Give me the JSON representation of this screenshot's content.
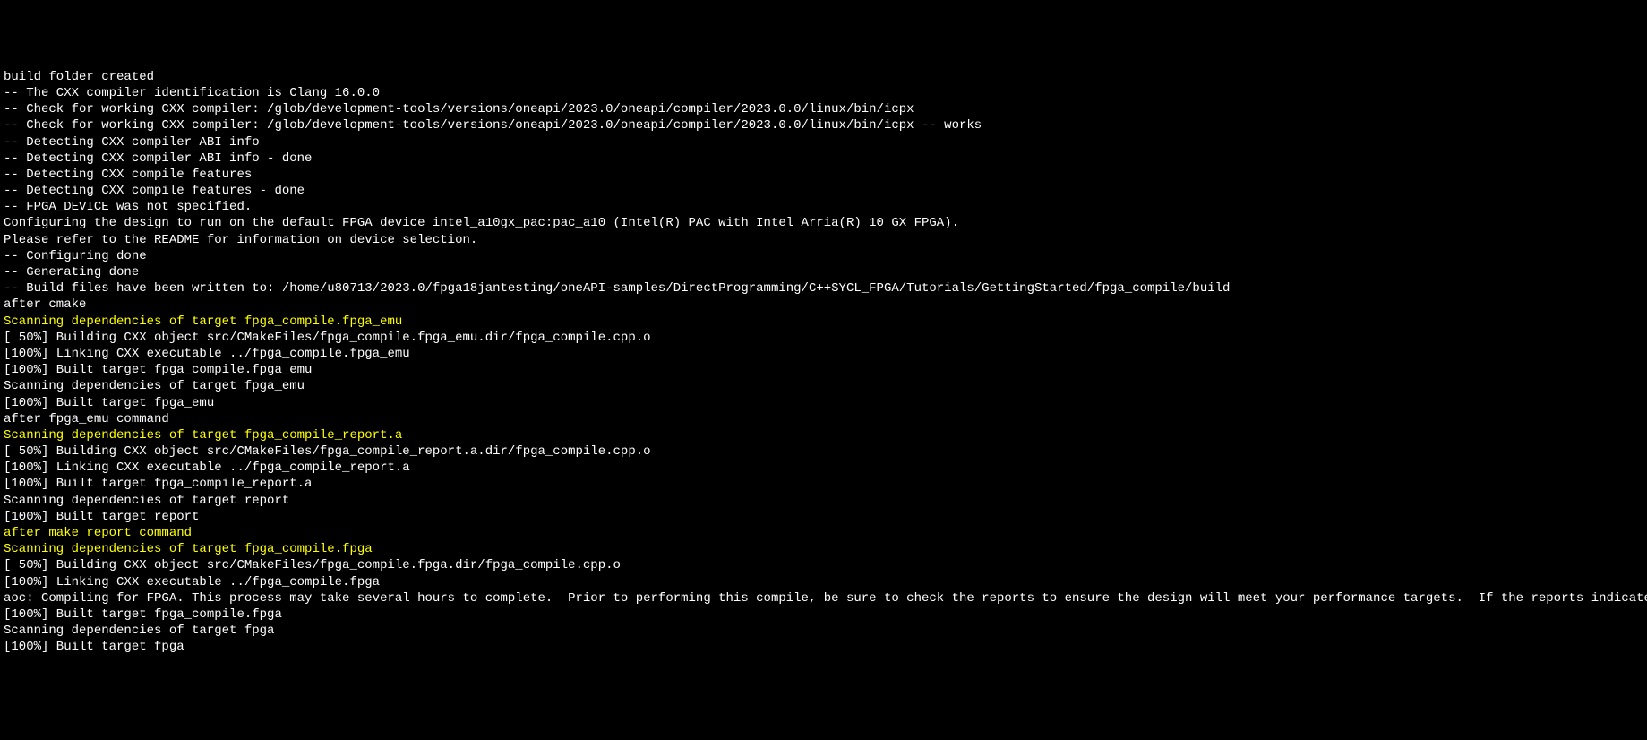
{
  "terminal": {
    "lines": [
      {
        "text": "build folder created",
        "color": "white"
      },
      {
        "text": "-- The CXX compiler identification is Clang 16.0.0",
        "color": "white"
      },
      {
        "text": "-- Check for working CXX compiler: /glob/development-tools/versions/oneapi/2023.0/oneapi/compiler/2023.0.0/linux/bin/icpx",
        "color": "white"
      },
      {
        "text": "-- Check for working CXX compiler: /glob/development-tools/versions/oneapi/2023.0/oneapi/compiler/2023.0.0/linux/bin/icpx -- works",
        "color": "white"
      },
      {
        "text": "-- Detecting CXX compiler ABI info",
        "color": "white"
      },
      {
        "text": "-- Detecting CXX compiler ABI info - done",
        "color": "white"
      },
      {
        "text": "-- Detecting CXX compile features",
        "color": "white"
      },
      {
        "text": "-- Detecting CXX compile features - done",
        "color": "white"
      },
      {
        "text": "-- FPGA_DEVICE was not specified.",
        "color": "white"
      },
      {
        "text": "Configuring the design to run on the default FPGA device intel_a10gx_pac:pac_a10 (Intel(R) PAC with Intel Arria(R) 10 GX FPGA).",
        "color": "white"
      },
      {
        "text": "Please refer to the README for information on device selection.",
        "color": "white"
      },
      {
        "text": "-- Configuring done",
        "color": "white"
      },
      {
        "text": "-- Generating done",
        "color": "white"
      },
      {
        "text": "-- Build files have been written to: /home/u80713/2023.0/fpga18jantesting/oneAPI-samples/DirectProgramming/C++SYCL_FPGA/Tutorials/GettingStarted/fpga_compile/build",
        "color": "white"
      },
      {
        "text": "after cmake",
        "color": "white"
      },
      {
        "text": "Scanning dependencies of target fpga_compile.fpga_emu",
        "color": "yellow"
      },
      {
        "text": "[ 50%] Building CXX object src/CMakeFiles/fpga_compile.fpga_emu.dir/fpga_compile.cpp.o",
        "color": "white"
      },
      {
        "text": "[100%] Linking CXX executable ../fpga_compile.fpga_emu",
        "color": "white"
      },
      {
        "text": "[100%] Built target fpga_compile.fpga_emu",
        "color": "white"
      },
      {
        "text": "Scanning dependencies of target fpga_emu",
        "color": "white"
      },
      {
        "text": "[100%] Built target fpga_emu",
        "color": "white"
      },
      {
        "text": "after fpga_emu command",
        "color": "white"
      },
      {
        "text": "Scanning dependencies of target fpga_compile_report.a",
        "color": "yellow"
      },
      {
        "text": "[ 50%] Building CXX object src/CMakeFiles/fpga_compile_report.a.dir/fpga_compile.cpp.o",
        "color": "white"
      },
      {
        "text": "[100%] Linking CXX executable ../fpga_compile_report.a",
        "color": "white"
      },
      {
        "text": "[100%] Built target fpga_compile_report.a",
        "color": "white"
      },
      {
        "text": "Scanning dependencies of target report",
        "color": "white"
      },
      {
        "text": "[100%] Built target report",
        "color": "white"
      },
      {
        "text": "after make report command",
        "color": "yellow"
      },
      {
        "text": "Scanning dependencies of target fpga_compile.fpga",
        "color": "yellow"
      },
      {
        "text": "[ 50%] Building CXX object src/CMakeFiles/fpga_compile.fpga.dir/fpga_compile.cpp.o",
        "color": "white"
      },
      {
        "text": "[100%] Linking CXX executable ../fpga_compile.fpga",
        "color": "white"
      },
      {
        "text": "aoc: Compiling for FPGA. This process may take several hours to complete.  Prior to performing this compile, be sure to check the reports to ensure the design will meet your performance targets.  If the reports indicate performance targets are not being met, code edits may be required.  Please refer to the oneAPI FPGA Optimization Guide for information on performance tuning applications for FPGAs.",
        "color": "white"
      },
      {
        "text": "[100%] Built target fpga_compile.fpga",
        "color": "white"
      },
      {
        "text": "Scanning dependencies of target fpga",
        "color": "white"
      },
      {
        "text": "[100%] Built target fpga",
        "color": "white"
      }
    ]
  }
}
